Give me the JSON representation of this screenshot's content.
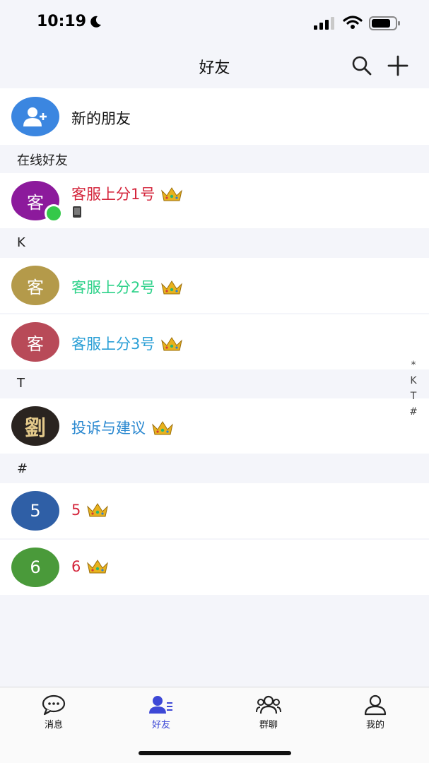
{
  "status_bar": {
    "time": "10:19"
  },
  "nav": {
    "title": "好友"
  },
  "new_friends": {
    "label": "新的朋友"
  },
  "sections": {
    "online": "在线好友",
    "k": "K",
    "t": "T",
    "hash": "#"
  },
  "contacts": [
    {
      "avatar_text": "客",
      "name": "客服上分1号",
      "name_color": "#d4263c",
      "online": true,
      "avatar_color": "#8c1a9c"
    },
    {
      "avatar_text": "客",
      "name": "客服上分2号",
      "name_color": "#2ed28a",
      "avatar_color": "#b49a4a"
    },
    {
      "avatar_text": "客",
      "name": "客服上分3号",
      "name_color": "#2a9fd6",
      "avatar_color": "#b84a58"
    },
    {
      "avatar_text": "劉",
      "name": "投诉与建议",
      "name_color": "#2a88d0",
      "avatar_color": "#2a2420"
    },
    {
      "avatar_text": "5",
      "name": "5",
      "name_color": "#d4263c",
      "avatar_color": "#2f5fa6"
    },
    {
      "avatar_text": "6",
      "name": "6",
      "name_color": "#d4263c",
      "avatar_color": "#4a9a3a"
    }
  ],
  "index_bar": [
    "*",
    "K",
    "T",
    "#"
  ],
  "tabs": [
    {
      "label": "消息",
      "icon": "chat-bubble-icon"
    },
    {
      "label": "好友",
      "icon": "friends-icon",
      "active": true
    },
    {
      "label": "群聊",
      "icon": "group-icon"
    },
    {
      "label": "我的",
      "icon": "person-icon"
    }
  ],
  "colors": {
    "accent": "#3d48d6",
    "online": "#35c94a",
    "new_friend_bg": "#3b86e0"
  }
}
